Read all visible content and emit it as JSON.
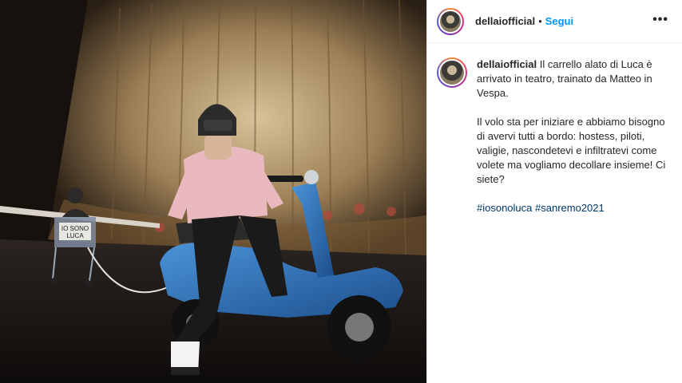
{
  "post": {
    "username": "dellaiofficial",
    "separator": "•",
    "follow_label": "Segui",
    "more_label": "•••",
    "caption_intro": " Il carrello alato di Luca è arrivato in teatro, trainato da Matteo in Vespa.",
    "caption_body": "Il volo sta per iniziare e abbiamo bisogno di avervi tutti a bordo: hostess, piloti, valigie, nascondetevi e infiltratevi come volete ma vogliamo decollare insieme! Ci siete?",
    "hashtags": [
      "#iosonoluca",
      "#sanremo2021"
    ],
    "photo_sign_text": [
      "IO SONO",
      "LUCA"
    ]
  },
  "colors": {
    "follow": "#0095f6",
    "hashtag": "#00376b",
    "vespa": "#2a6fb8",
    "hoodie": "#e9b9bf"
  }
}
